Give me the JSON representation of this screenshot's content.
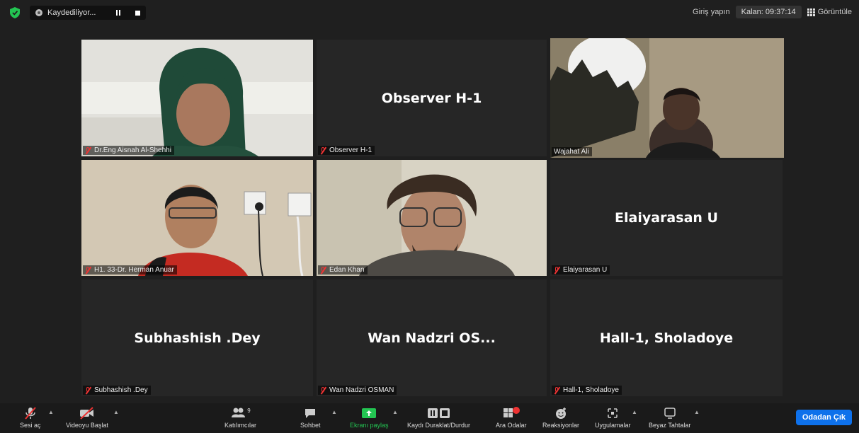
{
  "topbar": {
    "recording_label": "Kaydediliyor...",
    "signin": "Giriş yapın",
    "timer": "Kalan: 09:37:14",
    "view": "Görüntüle"
  },
  "tiles": [
    {
      "name": "Dr.Eng Aisnah Al-Shehhi",
      "video": true,
      "muted": true
    },
    {
      "name": "Observer H-1",
      "display": "Observer H-1",
      "video": false,
      "muted": true
    },
    {
      "name": "Wajahat Ali",
      "video": true,
      "muted": false,
      "active": true
    },
    {
      "name": "H1. 33-Dr. Herman Anuar",
      "video": true,
      "muted": true
    },
    {
      "name": "Edan Khan",
      "video": true,
      "muted": true
    },
    {
      "name": "Elaiyarasan U",
      "display": "Elaiyarasan U",
      "video": false,
      "muted": true
    },
    {
      "name": "Subhashish .Dey",
      "display": "Subhashish .Dey",
      "video": false,
      "muted": true
    },
    {
      "name": "Wan Nadzri OSMAN",
      "display": "Wan Nadzri OS...",
      "video": false,
      "muted": true
    },
    {
      "name": "Hall-1, Sholadoye",
      "display": "Hall-1, Sholadoye",
      "video": false,
      "muted": true
    }
  ],
  "toolbar": {
    "unmute": "Sesi aç",
    "start_video": "Videoyu Başlat",
    "participants": "Katılımcılar",
    "participants_count": "9",
    "chat": "Sohbet",
    "share": "Ekranı paylaş",
    "record": "Kaydı Duraklat/Durdur",
    "breakout": "Ara Odalar",
    "reactions": "Reaksiyonlar",
    "apps": "Uygulamalar",
    "whiteboard": "Beyaz Tahtalar",
    "leave": "Odadan Çık"
  },
  "colors": {
    "accent": "#0e71eb",
    "share": "#23c552",
    "active_outline": "#d3e667",
    "muted": "#e33333"
  }
}
